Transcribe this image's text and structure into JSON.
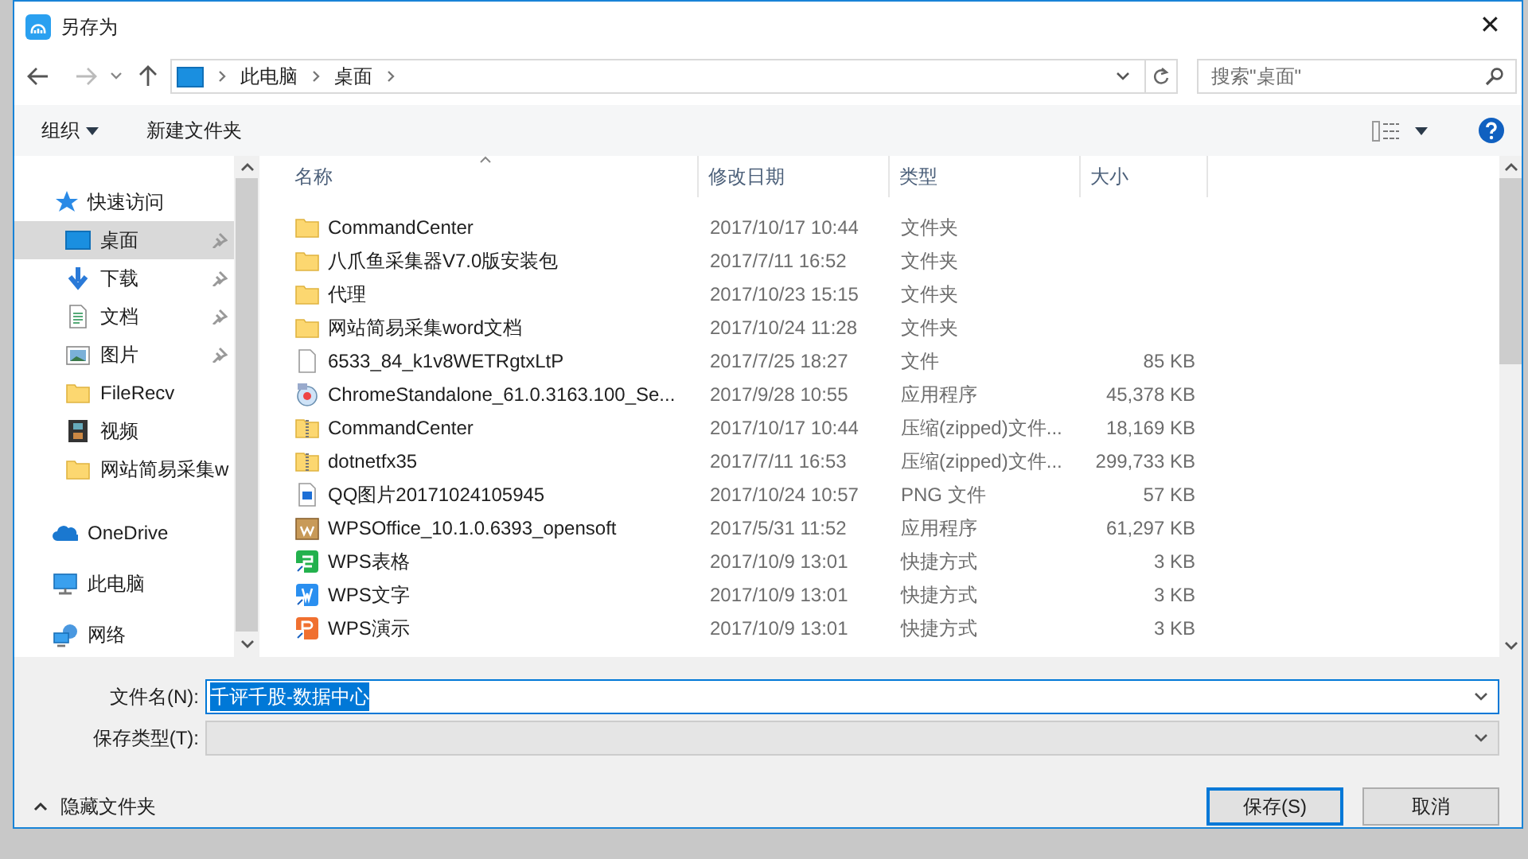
{
  "window": {
    "title": "另存为",
    "close": "✕"
  },
  "address": {
    "path": [
      "此电脑",
      "桌面"
    ]
  },
  "search": {
    "placeholder": "搜索\"桌面\""
  },
  "toolbar": {
    "organize": "组织",
    "new_folder": "新建文件夹"
  },
  "sidebar": {
    "items": [
      {
        "label": "快速访问",
        "kind": "quick",
        "selected": false,
        "pinned": false,
        "indent": false
      },
      {
        "label": "桌面",
        "kind": "desktop",
        "selected": true,
        "pinned": true,
        "indent": true
      },
      {
        "label": "下载",
        "kind": "download",
        "selected": false,
        "pinned": true,
        "indent": true
      },
      {
        "label": "文档",
        "kind": "document",
        "selected": false,
        "pinned": true,
        "indent": true
      },
      {
        "label": "图片",
        "kind": "picture",
        "selected": false,
        "pinned": true,
        "indent": true
      },
      {
        "label": "FileRecv",
        "kind": "folder",
        "selected": false,
        "pinned": false,
        "indent": true
      },
      {
        "label": "视频",
        "kind": "video",
        "selected": false,
        "pinned": false,
        "indent": true
      },
      {
        "label": "网站简易采集w",
        "kind": "folder",
        "selected": false,
        "pinned": false,
        "indent": true
      },
      {
        "label": "OneDrive",
        "kind": "cloud",
        "selected": false,
        "pinned": false,
        "indent": false
      },
      {
        "label": "此电脑",
        "kind": "computer",
        "selected": false,
        "pinned": false,
        "indent": false
      },
      {
        "label": "网络",
        "kind": "network",
        "selected": false,
        "pinned": false,
        "indent": false
      }
    ]
  },
  "table": {
    "columns": [
      {
        "label": "名称",
        "sorted": true
      },
      {
        "label": "修改日期",
        "sorted": false
      },
      {
        "label": "类型",
        "sorted": false
      },
      {
        "label": "大小",
        "sorted": false
      }
    ],
    "rows": [
      {
        "kind": "folder",
        "name": "CommandCenter",
        "date": "2017/10/17 10:44",
        "type": "文件夹",
        "size": ""
      },
      {
        "kind": "folder",
        "name": "八爪鱼采集器V7.0版安装包",
        "date": "2017/7/11 16:52",
        "type": "文件夹",
        "size": ""
      },
      {
        "kind": "folder",
        "name": "代理",
        "date": "2017/10/23 15:15",
        "type": "文件夹",
        "size": ""
      },
      {
        "kind": "folder",
        "name": "网站简易采集word文档",
        "date": "2017/10/24 11:28",
        "type": "文件夹",
        "size": ""
      },
      {
        "kind": "file",
        "name": "6533_84_k1v8WETRgtxLtP",
        "date": "2017/7/25 18:27",
        "type": "文件",
        "size": "85 KB"
      },
      {
        "kind": "app",
        "name": "ChromeStandalone_61.0.3163.100_Se...",
        "date": "2017/9/28 10:55",
        "type": "应用程序",
        "size": "45,378 KB"
      },
      {
        "kind": "zip",
        "name": "CommandCenter",
        "date": "2017/10/17 10:44",
        "type": "压缩(zipped)文件...",
        "size": "18,169 KB"
      },
      {
        "kind": "zip",
        "name": "dotnetfx35",
        "date": "2017/7/11 16:53",
        "type": "压缩(zipped)文件...",
        "size": "299,733 KB"
      },
      {
        "kind": "image",
        "name": "QQ图片20171024105945",
        "date": "2017/10/24 10:57",
        "type": "PNG 文件",
        "size": "57 KB"
      },
      {
        "kind": "package",
        "name": "WPSOffice_10.1.0.6393_opensoft",
        "date": "2017/5/31 11:52",
        "type": "应用程序",
        "size": "61,297 KB"
      },
      {
        "kind": "sheet",
        "name": "WPS表格",
        "date": "2017/10/9 13:01",
        "type": "快捷方式",
        "size": "3 KB"
      },
      {
        "kind": "writer",
        "name": "WPS文字",
        "date": "2017/10/9 13:01",
        "type": "快捷方式",
        "size": "3 KB"
      },
      {
        "kind": "slides",
        "name": "WPS演示",
        "date": "2017/10/9 13:01",
        "type": "快捷方式",
        "size": "3 KB"
      }
    ]
  },
  "filename": {
    "label": "文件名(N):",
    "value": "千评千股-数据中心",
    "text_selected": true
  },
  "filetype": {
    "label": "保存类型(T):",
    "disabled": true
  },
  "hide_folders": "隐藏文件夹",
  "buttons": [
    {
      "label": "保存(S)",
      "default": true
    },
    {
      "label": "取消",
      "default": false
    }
  ]
}
